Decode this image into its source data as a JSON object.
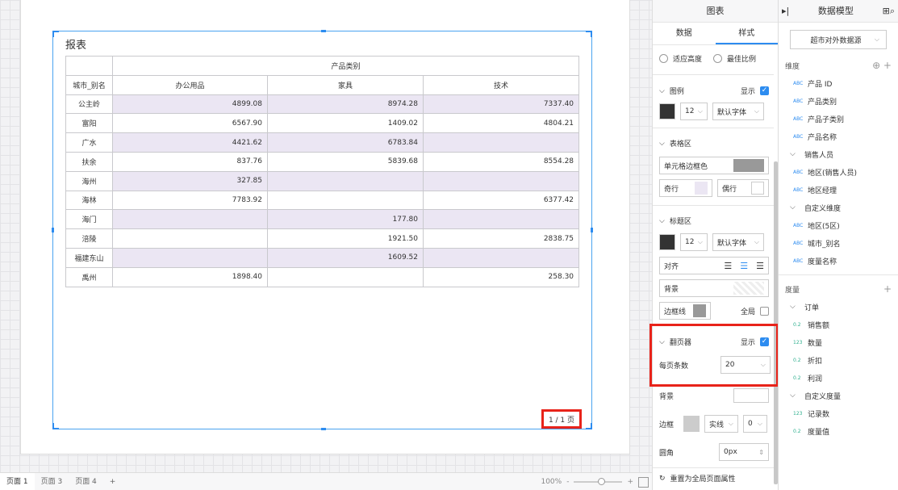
{
  "report": {
    "title": "报表",
    "group_header": "产品类别",
    "columns": [
      "城市_别名",
      "办公用品",
      "家具",
      "技术"
    ],
    "rows": [
      [
        "公主岭",
        "4899.08",
        "8974.28",
        "7337.40"
      ],
      [
        "富阳",
        "6567.90",
        "1409.02",
        "4804.21"
      ],
      [
        "广水",
        "4421.62",
        "6783.84",
        ""
      ],
      [
        "扶余",
        "837.76",
        "5839.68",
        "8554.28"
      ],
      [
        "海州",
        "327.85",
        "",
        ""
      ],
      [
        "海林",
        "7783.92",
        "",
        "6377.42"
      ],
      [
        "海门",
        "",
        "177.80",
        ""
      ],
      [
        "涪陵",
        "",
        "1921.50",
        "2838.75"
      ],
      [
        "福建东山",
        "",
        "1609.52",
        ""
      ],
      [
        "禹州",
        "1898.40",
        "",
        "258.30"
      ]
    ],
    "pager": "1 / 1 页"
  },
  "bottombar": {
    "tabs": [
      "页面 1",
      "页面 3",
      "页面 4"
    ],
    "add": "+",
    "zoom": "100%",
    "minus": "-",
    "plus": "+"
  },
  "props": {
    "title": "图表",
    "tabs": [
      "数据",
      "样式"
    ],
    "size_opt1": "适应高度",
    "size_opt2": "最佳比例",
    "legend": {
      "label": "图例",
      "show": "显示",
      "font_size": "12",
      "font": "默认字体"
    },
    "table": {
      "label": "表格区",
      "border_color": "单元格边框色",
      "odd": "奇行",
      "even": "偶行"
    },
    "titlearea": {
      "label": "标题区",
      "font_size": "12",
      "font": "默认字体",
      "align": "对齐",
      "bg": "背景",
      "border": "边框线",
      "global": "全局"
    },
    "pager": {
      "label": "翻页器",
      "show": "显示",
      "per_page": "每页条数",
      "per_page_value": "20"
    },
    "background": "背景",
    "border": {
      "label": "边框",
      "style": "实线",
      "width": "0"
    },
    "radius": {
      "label": "圆角",
      "value": "0px"
    },
    "reset": "重置为全局页面属性"
  },
  "model": {
    "title": "数据模型",
    "datasource": "超市对外数据源",
    "dims_label": "维度",
    "dims": [
      {
        "tag": "ABC",
        "name": "产品 ID"
      },
      {
        "tag": "ABC",
        "name": "产品类别"
      },
      {
        "tag": "ABC",
        "name": "产品子类别"
      },
      {
        "tag": "ABC",
        "name": "产品名称"
      },
      {
        "tag": "folder",
        "name": "销售人员"
      },
      {
        "tag": "ABC",
        "name": "地区(销售人员)"
      },
      {
        "tag": "ABC",
        "name": "地区经理"
      },
      {
        "tag": "folder",
        "name": "自定义维度"
      },
      {
        "tag": "ABC",
        "name": "地区(5区)"
      },
      {
        "tag": "ABC",
        "name": "城市_别名"
      },
      {
        "tag": "ABC",
        "name": "度量名称"
      }
    ],
    "measures_label": "度量",
    "measures": [
      {
        "tag": "folder",
        "name": "订单"
      },
      {
        "tag": "0.2",
        "name": "销售额"
      },
      {
        "tag": "123",
        "name": "数量"
      },
      {
        "tag": "0.2",
        "name": "折扣"
      },
      {
        "tag": "0.2",
        "name": "利润"
      },
      {
        "tag": "folder",
        "name": "自定义度量"
      },
      {
        "tag": "123",
        "name": "记录数"
      },
      {
        "tag": "0.2",
        "name": "度量值"
      }
    ]
  }
}
